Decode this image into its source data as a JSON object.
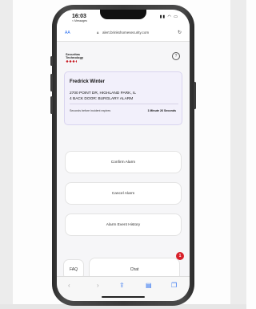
{
  "status_bar": {
    "time": "16:03",
    "carrier": "< Messages",
    "icons": "▮▮ ◠ ▭"
  },
  "browser": {
    "aa_label": "AA",
    "url": "alert.brinkshomesecurity.com"
  },
  "header": {
    "logo_line1": "Securitas",
    "logo_line2": "Technology",
    "help_icon": "?"
  },
  "incident": {
    "name": "Fredrick Winter",
    "address_line1": "2700 POINT DR, HIGHLAND PARK, IL",
    "address_line2": "4 BACK DOOR: BURGLARY ALARM",
    "expires_label": "Seconds before incident expires",
    "countdown": "1 Minute 26 Seconds"
  },
  "actions": {
    "confirm": "Confirm Alarm",
    "cancel": "Cancel Alarm",
    "history": "Alarm Event History"
  },
  "footer": {
    "faq": "FAQ",
    "chat": "Chat",
    "chat_badge": "1"
  },
  "icons": {
    "back": "chevron-left-icon",
    "forward": "chevron-right-icon",
    "share": "share-icon",
    "bookmarks": "book-icon",
    "tabs": "tabs-icon"
  },
  "colors": {
    "accent_red": "#d8202a",
    "card_bg": "#f2f0fb",
    "ios_blue": "#2a6ef0"
  }
}
